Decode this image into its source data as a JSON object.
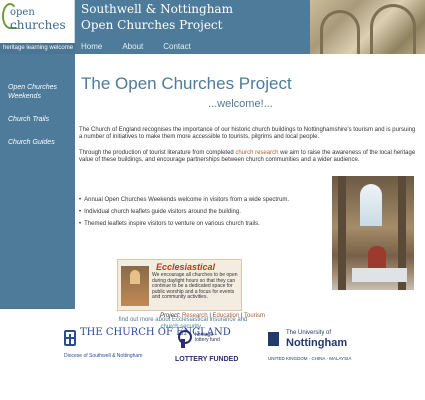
{
  "logo": {
    "line1": "open",
    "line2": "churches",
    "tagline": "heritage learning welcome"
  },
  "header": {
    "title_line1": "Southwell & Nottingham",
    "title_line2": "Open Churches Project"
  },
  "topnav": [
    {
      "label": "Home"
    },
    {
      "label": "About"
    },
    {
      "label": "Contact"
    }
  ],
  "sidebar": {
    "items": [
      {
        "label": "Open Churches Weekends"
      },
      {
        "label": "Church Trails"
      },
      {
        "label": "Church Guides"
      }
    ]
  },
  "main": {
    "title": "The Open Churches Project",
    "welcome": "...welcome!...",
    "intro": "The Church of England recognises the importance of our historic church buildings to Nottinghamshire's tourism and is pursuing a number of initiatives to make them more accessible to tourists, pilgrims and local people.",
    "intro2_before": "Through the production of tourist literature from completed ",
    "intro2_link": "church research",
    "intro2_after": " we aim to raise the awareness of the local heritage value of these buildings, and encourage partnerships between church communities and a wider audience.",
    "bullets": [
      "Annual Open Churches Weekends welcome in visitors from a wide spectrum.",
      "Individual church leaflets guide visitors around the building.",
      "Themed leaflets inspire visitors to venture on various church trails."
    ]
  },
  "ecclesiastical": {
    "brand": "Ecclesiastical",
    "text": "We encourage all churches to be open during daylight hours so that they can continue to be a dedicated space for public worship and a focus for events and community activities.",
    "link_text": "find out more about Ecclesiastical insurance and church security..."
  },
  "footer": {
    "project_label": "Project:",
    "project_links": [
      "Research",
      "Education",
      "Tourism"
    ],
    "separator": " | "
  },
  "logos": {
    "coe_name": "THE CHURCH OF ENGLAND",
    "coe_sub": "Diocese of Southwell & Nottingham",
    "lottery_top": "heritage lottery fund",
    "lottery_bottom": "LOTTERY FUNDED",
    "uon_top": "The University of",
    "uon_name": "Nottingham",
    "uon_sub": "UNITED KINGDOM · CHINA · MALAYSIA"
  },
  "colors": {
    "brand_blue": "#4e7b9a",
    "link_orange": "#b35a32"
  }
}
